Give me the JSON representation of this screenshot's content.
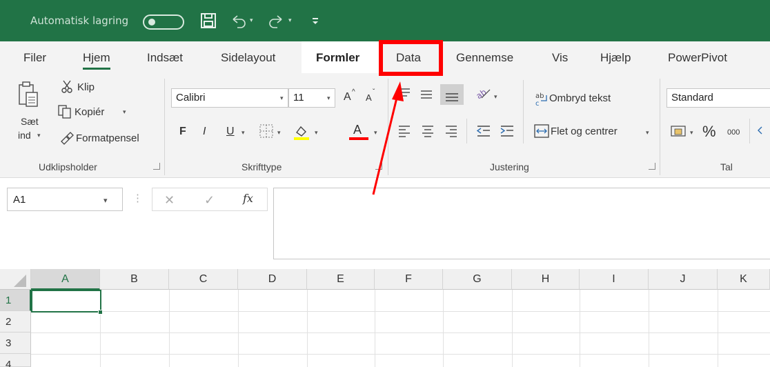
{
  "titlebar": {
    "autosave_label": "Automatisk lagring",
    "bg_color": "#217346",
    "icons": [
      "toggle-off",
      "save-icon",
      "undo-icon",
      "redo-icon",
      "qat-more-icon"
    ]
  },
  "tabs": [
    {
      "label": "Filer"
    },
    {
      "label": "Hjem",
      "state": "active"
    },
    {
      "label": "Indsæt"
    },
    {
      "label": "Sidelayout"
    },
    {
      "label": "Formler",
      "state": "bold"
    },
    {
      "label": "Data",
      "state": "highlighted"
    },
    {
      "label": "Gennemse"
    },
    {
      "label": "Vis"
    },
    {
      "label": "Hjælp"
    },
    {
      "label": "PowerPivot"
    }
  ],
  "ribbon": {
    "clipboard": {
      "paste_label_1": "Sæt",
      "paste_label_2": "ind",
      "cut_label": "Klip",
      "copy_label": "Kopiér",
      "format_painter_label": "Formatpensel",
      "group_label": "Udklipsholder"
    },
    "font": {
      "font_name": "Calibri",
      "font_size": "11",
      "bold": "F",
      "italic": "I",
      "underline": "U",
      "grow": "A",
      "shrink": "A",
      "font_color_letter": "A",
      "group_label": "Skrifttype",
      "highlight_color": "#ffff00",
      "font_color": "#ff0000"
    },
    "alignment": {
      "wrap_text_label": "Ombryd tekst",
      "merge_center_label": "Flet og centrer",
      "group_label": "Justering"
    },
    "number": {
      "format": "Standard",
      "percent": "%",
      "thousands": "000",
      "group_label": "Tal"
    }
  },
  "formula_bar": {
    "name_box": "A1",
    "cancel": "✕",
    "enter": "✓",
    "fx": "fx",
    "value": ""
  },
  "grid": {
    "columns": [
      "A",
      "B",
      "C",
      "D",
      "E",
      "F",
      "G",
      "H",
      "I",
      "J",
      "K"
    ],
    "rows": [
      "1",
      "2",
      "3",
      "4"
    ],
    "selected_cell": "A1"
  },
  "annotation": {
    "highlight_color": "#ff0000",
    "target": "Data"
  }
}
